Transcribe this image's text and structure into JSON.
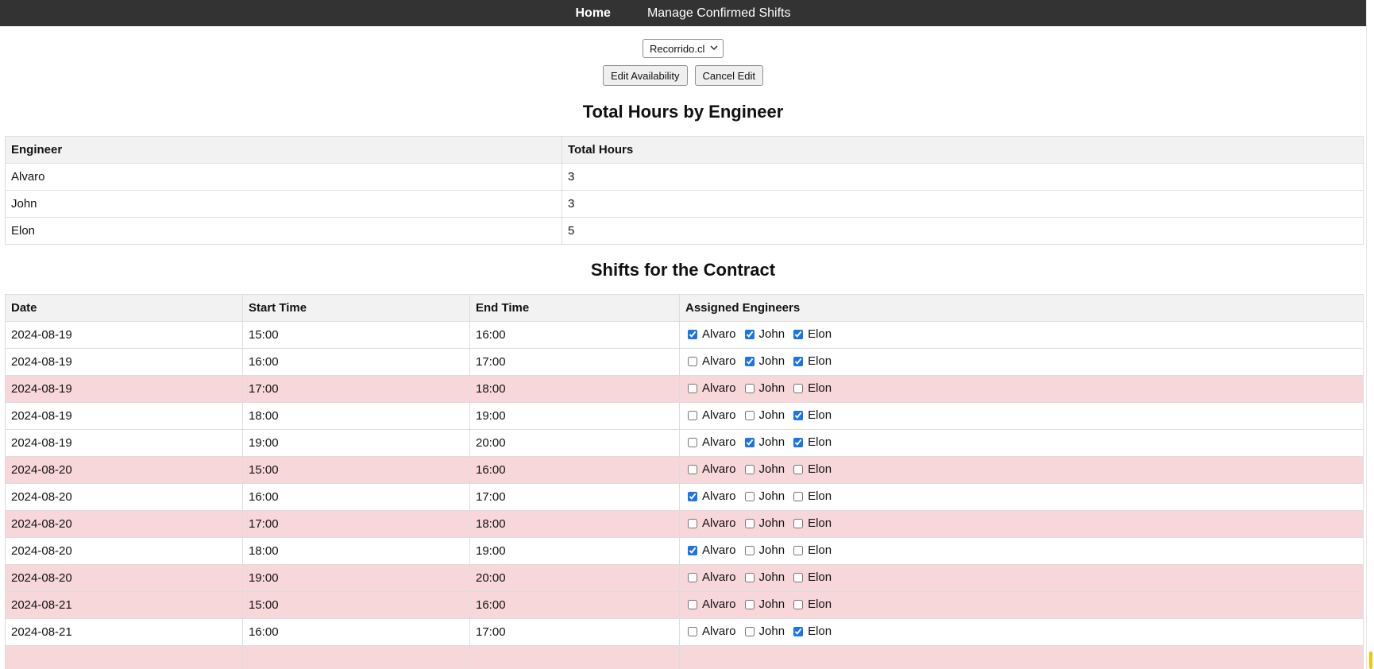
{
  "nav": {
    "items": [
      {
        "label": "Home",
        "active": true
      },
      {
        "label": "Manage Confirmed Shifts",
        "active": false
      }
    ]
  },
  "controls": {
    "contract_select": {
      "value": "Recorrido.cl"
    },
    "edit_button": "Edit Availability",
    "cancel_button": "Cancel Edit"
  },
  "hours": {
    "title": "Total Hours by Engineer",
    "headers": [
      "Engineer",
      "Total Hours"
    ],
    "rows": [
      {
        "engineer": "Alvaro",
        "hours": "3"
      },
      {
        "engineer": "John",
        "hours": "3"
      },
      {
        "engineer": "Elon",
        "hours": "5"
      }
    ]
  },
  "shifts": {
    "title": "Shifts for the Contract",
    "headers": [
      "Date",
      "Start Time",
      "End Time",
      "Assigned Engineers"
    ],
    "engineers": [
      "Alvaro",
      "John",
      "Elon"
    ],
    "rows": [
      {
        "date": "2024-08-19",
        "start": "15:00",
        "end": "16:00",
        "assigned": [
          true,
          true,
          true
        ]
      },
      {
        "date": "2024-08-19",
        "start": "16:00",
        "end": "17:00",
        "assigned": [
          false,
          true,
          true
        ]
      },
      {
        "date": "2024-08-19",
        "start": "17:00",
        "end": "18:00",
        "assigned": [
          false,
          false,
          false
        ]
      },
      {
        "date": "2024-08-19",
        "start": "18:00",
        "end": "19:00",
        "assigned": [
          false,
          false,
          true
        ]
      },
      {
        "date": "2024-08-19",
        "start": "19:00",
        "end": "20:00",
        "assigned": [
          false,
          true,
          true
        ]
      },
      {
        "date": "2024-08-20",
        "start": "15:00",
        "end": "16:00",
        "assigned": [
          false,
          false,
          false
        ]
      },
      {
        "date": "2024-08-20",
        "start": "16:00",
        "end": "17:00",
        "assigned": [
          true,
          false,
          false
        ]
      },
      {
        "date": "2024-08-20",
        "start": "17:00",
        "end": "18:00",
        "assigned": [
          false,
          false,
          false
        ]
      },
      {
        "date": "2024-08-20",
        "start": "18:00",
        "end": "19:00",
        "assigned": [
          true,
          false,
          false
        ]
      },
      {
        "date": "2024-08-20",
        "start": "19:00",
        "end": "20:00",
        "assigned": [
          false,
          false,
          false
        ]
      },
      {
        "date": "2024-08-21",
        "start": "15:00",
        "end": "16:00",
        "assigned": [
          false,
          false,
          false
        ]
      },
      {
        "date": "2024-08-21",
        "start": "16:00",
        "end": "17:00",
        "assigned": [
          false,
          false,
          true
        ]
      },
      {
        "date": "",
        "start": "",
        "end": "",
        "assigned": [
          false,
          false,
          false
        ]
      }
    ]
  },
  "colors": {
    "navbar_bg": "#333333",
    "unassigned_row_bg": "#f8d7da",
    "header_bg": "#f2f2f2",
    "checkbox_accent": "#1a73e8"
  },
  "icons": {
    "select_chevron": "chevron-down-icon"
  }
}
